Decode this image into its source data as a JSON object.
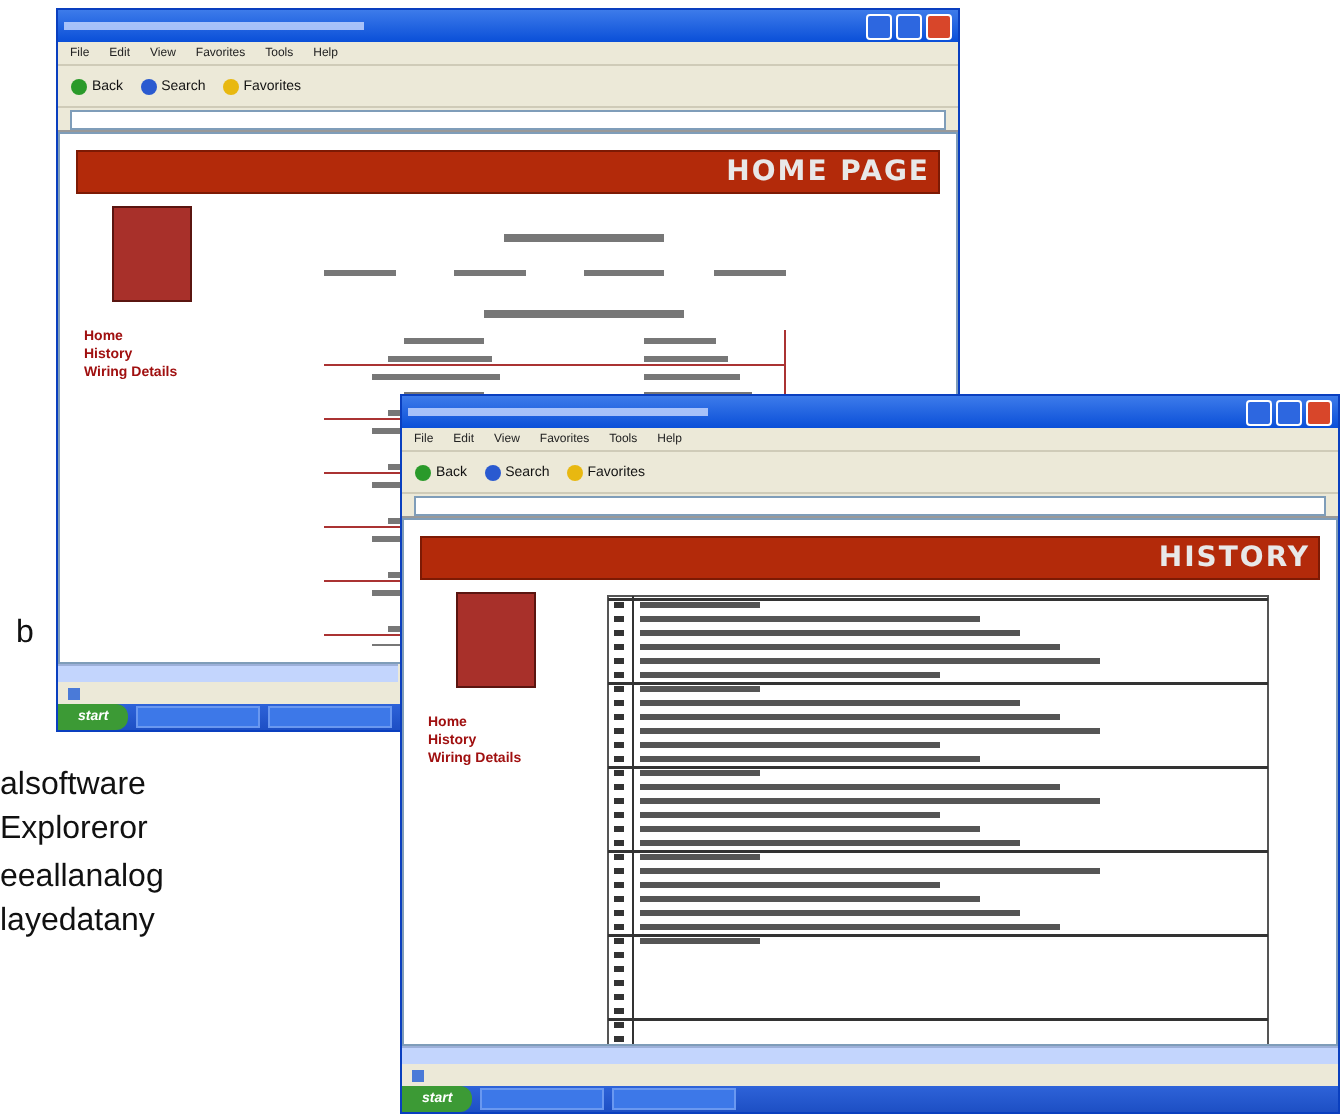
{
  "windows": [
    {
      "kind": "home",
      "menu": [
        "File",
        "Edit",
        "View",
        "Favorites",
        "Tools",
        "Help"
      ],
      "toolbar": [
        "Back",
        "Search",
        "Favorites"
      ],
      "banner": "HOME PAGE",
      "nav": [
        "Home",
        "History",
        "Wiring Details"
      ],
      "start": "start"
    },
    {
      "kind": "history",
      "menu": [
        "File",
        "Edit",
        "View",
        "Favorites",
        "Tools",
        "Help"
      ],
      "toolbar": [
        "Back",
        "Search",
        "Favorites"
      ],
      "banner": "HISTORY",
      "nav": [
        "Home",
        "History",
        "Wiring Details"
      ],
      "start": "start"
    }
  ],
  "caption": [
    "b",
    "alsoftware",
    "Explоreror",
    "eeallanalog",
    "layedatany"
  ]
}
